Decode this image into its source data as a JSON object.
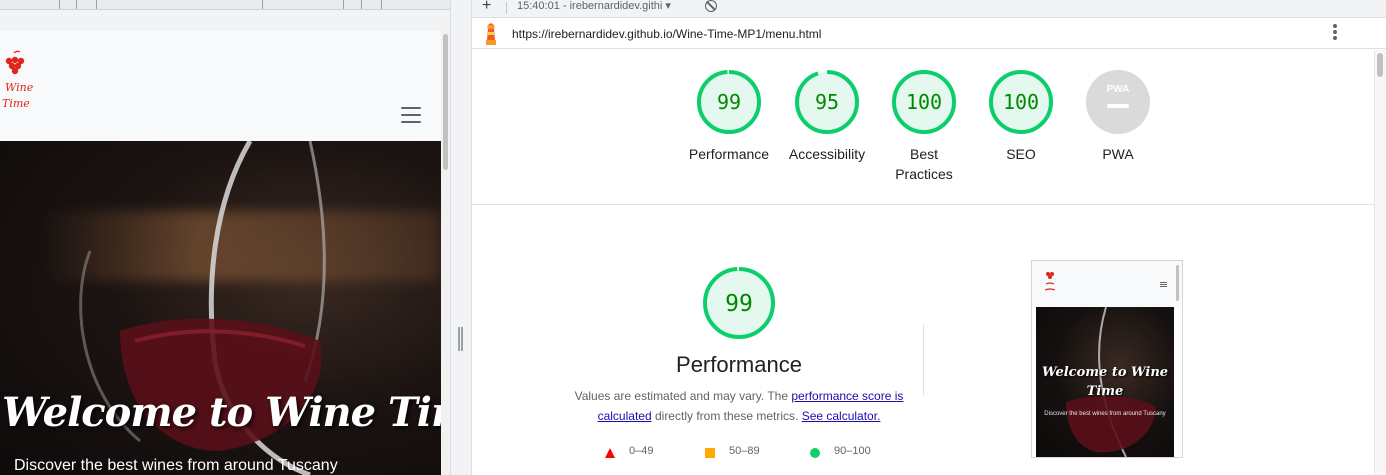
{
  "devtools": {
    "timestamp": "15:40:01 - irebernardidev.githi",
    "dropdown_glyph": "▾",
    "plus": "+",
    "url": "https://irebernardidev.github.io/Wine-Time-MP1/menu.html"
  },
  "site_preview": {
    "hero_title": "Welcome to Wine Time",
    "hero_subtitle": "Discover the best wines from around Tuscany",
    "logo_text_top": "Wine",
    "logo_text_bottom": "Time"
  },
  "summary": {
    "gauges": [
      {
        "label": "Performance",
        "score": "99",
        "fill": 0.99
      },
      {
        "label": "Accessibility",
        "score": "95",
        "fill": 0.95
      },
      {
        "label": "Best\nPractices",
        "score": "100",
        "fill": 1.0
      },
      {
        "label": "SEO",
        "score": "100",
        "fill": 1.0
      },
      {
        "label": "PWA",
        "score": "PWA",
        "fill": 0
      }
    ]
  },
  "performance": {
    "score": "99",
    "fill": 0.99,
    "title": "Performance",
    "desc_part1": "Values are estimated and may vary. The ",
    "link_score": "performance score is calculated",
    "desc_part2": " directly from these metrics. ",
    "link_calculator": "See calculator.",
    "legend": [
      {
        "range": "0–49",
        "shape": "triangle",
        "color": "#ff0000"
      },
      {
        "range": "50–89",
        "shape": "square",
        "color": "#ffaa00"
      },
      {
        "range": "90–100",
        "shape": "circle",
        "color": "#0cce6b"
      }
    ]
  },
  "screenshot_thumb": {
    "title": "Welcome to Wine Time",
    "subtitle": "Discover the best wines from around Tuscany"
  },
  "colors": {
    "pass": "#0cce6b",
    "pass_text": "#008800",
    "pass_bg": "#e5f8ef",
    "na": "#bdbdbd",
    "logo_red": "#e0261b"
  }
}
